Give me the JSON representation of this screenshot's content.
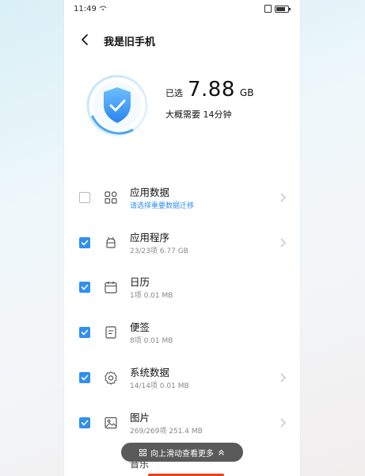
{
  "status_bar": {
    "time": "11:49",
    "signal": "···"
  },
  "header": {
    "title": "我是旧手机"
  },
  "summary": {
    "selected_label": "已选",
    "size_value": "7.88",
    "size_unit": "GB",
    "estimate": "大概需要 14分钟"
  },
  "colors": {
    "accent": "#2f8ff2",
    "shield_top": "#5fb6ff",
    "shield_bottom": "#2a86f0"
  },
  "items": [
    {
      "name": "app-data",
      "title": "应用数据",
      "subtitle": "请选择重要数据迁移",
      "checked": false,
      "has_chevron": true,
      "icon": "apps-grid-icon"
    },
    {
      "name": "applications",
      "title": "应用程序",
      "subtitle": "23/23项  6.77 GB",
      "checked": true,
      "has_chevron": true,
      "icon": "android-icon"
    },
    {
      "name": "calendar",
      "title": "日历",
      "subtitle": "1项  0.01 MB",
      "checked": true,
      "has_chevron": false,
      "icon": "calendar-icon"
    },
    {
      "name": "notes",
      "title": "便签",
      "subtitle": "8项  0.01 MB",
      "checked": true,
      "has_chevron": false,
      "icon": "note-icon"
    },
    {
      "name": "system-data",
      "title": "系统数据",
      "subtitle": "14/14项  0.01 MB",
      "checked": true,
      "has_chevron": true,
      "icon": "gear-icon"
    },
    {
      "name": "pictures",
      "title": "图片",
      "subtitle": "269/269项  251.4 MB",
      "checked": true,
      "has_chevron": true,
      "icon": "image-icon"
    }
  ],
  "scroll_hint": {
    "label": "向上滑动查看更多"
  },
  "peek_item": {
    "title": "音乐"
  }
}
